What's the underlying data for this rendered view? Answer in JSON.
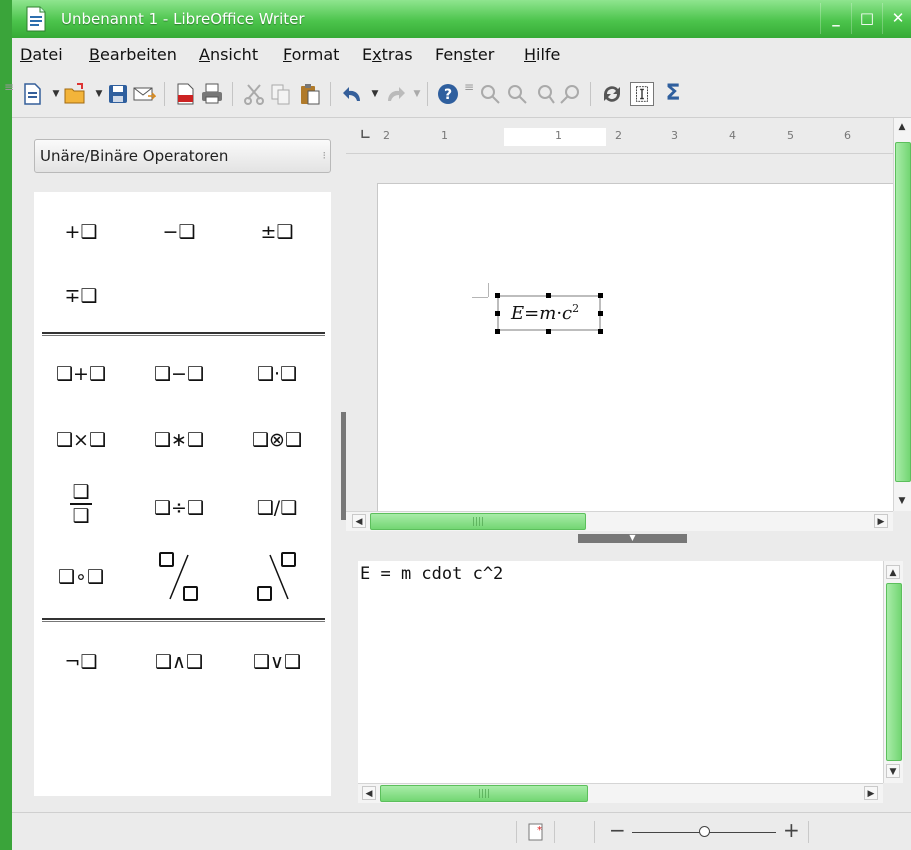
{
  "window": {
    "title": "Unbenannt 1 - LibreOffice Writer",
    "controls": {
      "minimize": "_",
      "maximize": "□",
      "close": "✕"
    }
  },
  "menu": [
    "Datei",
    "Bearbeiten",
    "Ansicht",
    "Format",
    "Extras",
    "Fenster",
    "Hilfe"
  ],
  "menu_mnemonics": [
    "D",
    "B",
    "A",
    "F",
    "x",
    "s",
    "H"
  ],
  "toolbar": {
    "icons": [
      "new-document-icon",
      "open-folder-icon",
      "save-icon",
      "email-icon",
      "export-pdf-icon",
      "print-icon",
      "cut-icon",
      "copy-icon",
      "paste-icon",
      "undo-icon",
      "redo-icon",
      "help-icon",
      "zoom-in-icon",
      "zoom-out-icon",
      "zoom-100-icon",
      "zoom-page-icon",
      "update-icon",
      "formula-cursor-icon",
      "sigma-icon"
    ]
  },
  "elements": {
    "category": "Unäre/Binäre Operatoren",
    "dropdown_arrow": "⁝",
    "symbols_group1": [
      "+❑",
      "−❑",
      "±❑",
      "∓❑"
    ],
    "symbols_group2": [
      "❑+❑",
      "❑−❑",
      "❑·❑",
      "❑×❑",
      "❑∗❑",
      "❑⊗❑",
      "❑÷❑",
      "❑/❑",
      "❑∘❑"
    ],
    "fraction_symbol": {
      "top": "❑",
      "bottom": "❑"
    },
    "slash_symbols": [
      "❑/❑ wide",
      "❑\\❑ wide"
    ],
    "symbols_group3": [
      "¬❑",
      "❑∧❑",
      "❑∨❑"
    ]
  },
  "ruler": {
    "labels": [
      "2",
      "1",
      "1",
      "2",
      "3",
      "4",
      "5",
      "6"
    ]
  },
  "document": {
    "formula": {
      "lhs": "E",
      "op": "=",
      "m": "m",
      "dot": "·",
      "c": "c",
      "exp": "2"
    }
  },
  "command": {
    "text": "E = m cdot c^2"
  },
  "status": {
    "zoom_minus": "−",
    "zoom_plus": "+",
    "doc_modified_icon": "document-modified-icon"
  },
  "colors": {
    "titlebar": "#4cc44c",
    "scroll_thumb": "#73d673",
    "background": "#ebebeb"
  }
}
